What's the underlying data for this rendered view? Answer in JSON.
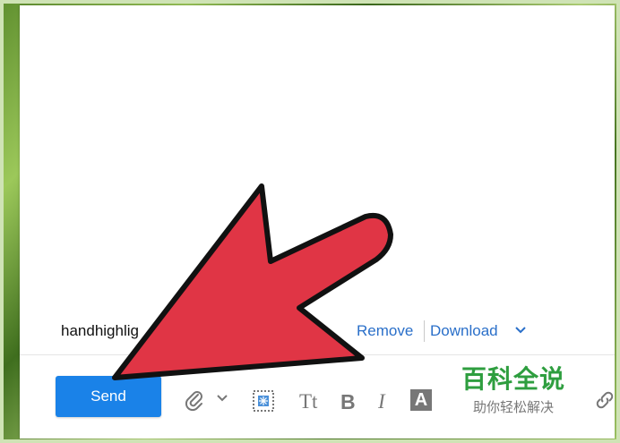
{
  "attachment": {
    "file_name": "handhighlig",
    "remove_label": "Remove",
    "download_label": "Download",
    "menu_icon": "chevron-down-icon"
  },
  "toolbar": {
    "send_label": "Send",
    "attach_icon": "paperclip-icon",
    "attach_menu_icon": "chevron-down-icon",
    "stationery_icon": "stationery-icon",
    "font_size_label": "Tt",
    "bold_label": "B",
    "italic_label": "I",
    "font_color_label": "A",
    "link_icon": "link-icon"
  },
  "overlay": {
    "arrow_color": "#e03545",
    "arrow_icon": "pointer-arrow-icon"
  },
  "watermark": {
    "title": "百科全说",
    "subtitle": "助你轻松解决"
  },
  "colors": {
    "accent": "#1a82e8",
    "link": "#2a6fc9",
    "watermark_green": "#2e9e3f"
  }
}
